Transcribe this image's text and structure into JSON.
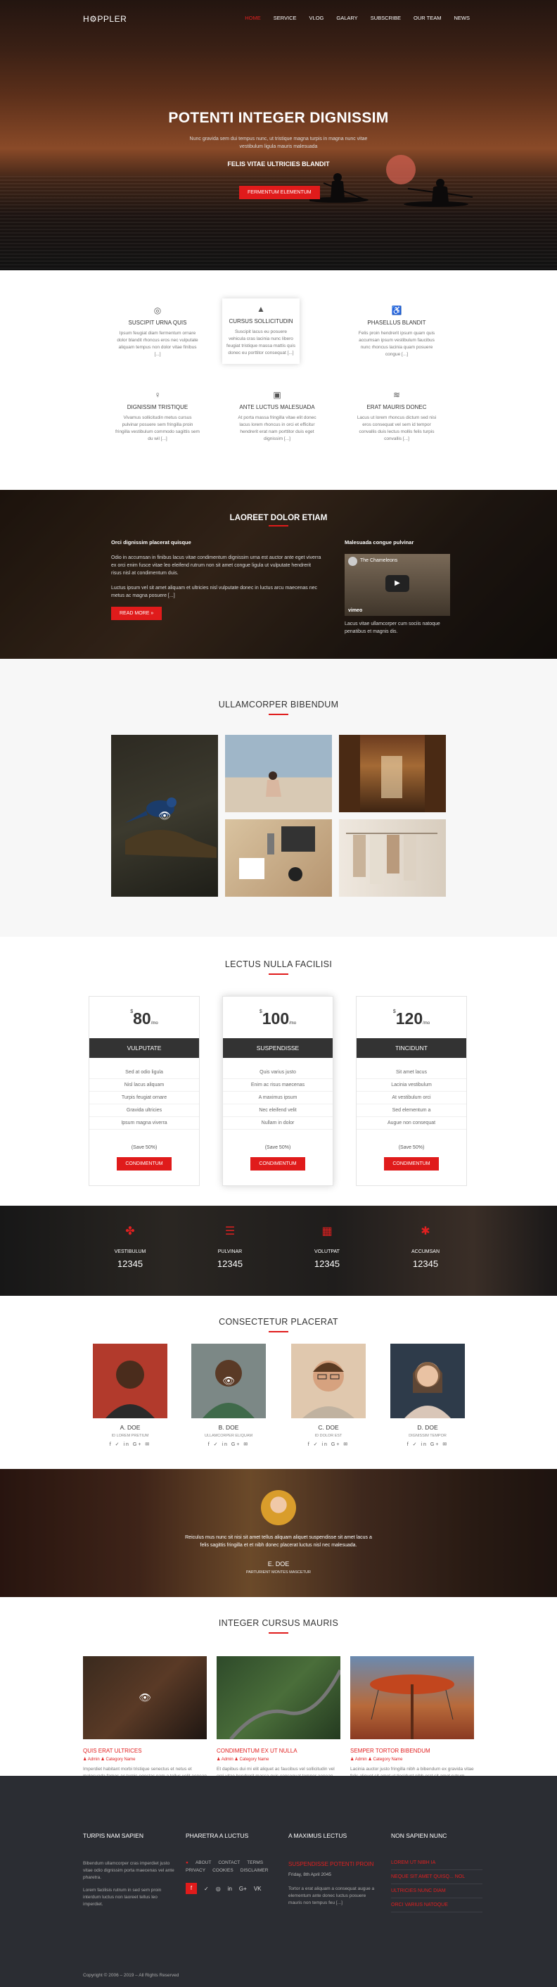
{
  "nav": {
    "logo": "H⚙PPLER",
    "items": [
      "HOME",
      "SERVICE",
      "VLOG",
      "GALARY",
      "SUBSCRIBE",
      "OUR TEAM",
      "NEWS"
    ],
    "active_index": 0
  },
  "hero": {
    "title": "POTENTI INTEGER DIGNISSIM",
    "text": "Nunc gravida sem dui tempus nunc, ut tristique magna turpis in magna nunc vitae vestibulum ligula mauris malesuada",
    "subtitle": "FELIS VITAE ULTRICIES BLANDIT",
    "button": "FERMENTUM ELEMENTUM"
  },
  "services": [
    {
      "icon": "aperture-icon",
      "title": "SUSCIPIT URNA QUIS",
      "text": "Ipsum feugiat diam fermentum ornare dolor blandit rhoncus eros nec vulputate aliquam tempus non dolor vitae finibus [...]"
    },
    {
      "icon": "triangle-logo-icon",
      "title": "CURSUS SOLLICITUDIN",
      "text": "Suscipit lacus eu posuere vehicula cras lacinia nunc libero feugiat tristique massa mattis quis donec eu porttitor consequat [...]"
    },
    {
      "icon": "accessibility-icon",
      "title": "PHASELLUS BLANDIT",
      "text": "Felis proin hendrerit ipsum quam quis accumsan ipsum vestibulum faucibus nunc rhoncus lacinia quam posuere congue [...]"
    },
    {
      "icon": "lightbulb-icon",
      "title": "DIGNISSIM TRISTIQUE",
      "text": "Vivamus sollicitudin metus cursus pulvinar posuere sem fringilla proin fringilla vestibulum commodo sagittis sem du wil [...]"
    },
    {
      "icon": "lock-icon",
      "title": "ANTE LUCTUS MALESUADA",
      "text": "At porta massa fringilla vitae elit donec lacus lorem rhoncus in orci et efficitur hendrerit erat nam porttitor duis eget dignissim [...]"
    },
    {
      "icon": "stack-icon",
      "title": "ERAT MAURIS DONEC",
      "text": "Lacus ut lorem rhoncus dictum sed nisi eros consequat vel sem id tempor convallis duis lectus mollis felis turpis convallis [...]"
    }
  ],
  "about": {
    "title": "LAOREET DOLOR ETIAM",
    "left_heading": "Orci dignissim placerat quisque",
    "p1": "Odio in accumsan in finibus lacus vitae condimentum dignissim urna est auctor ante eget viverra ex orci enim fusce vitae leo eleifend rutrum non sit amet congue ligula ut vulputate hendrerit risus nisl at condimentum duis.",
    "p2": "Luctus ipsum vel sit amet aliquam et ultricies nisl vulputate donec in luctus arcu maecenas nec metus ac magna posuere [...]",
    "button": "READ MORE »",
    "right_heading": "Malesuada congue pulvinar",
    "video_title": "The Chameleons",
    "video_brand": "vimeo",
    "right_text": "Lacus vitae ullamcorper cum sociis natoque penatibus et magnis dis."
  },
  "gallery": {
    "title": "ULLAMCORPER BIBENDUM"
  },
  "pricing": {
    "title": "LECTUS NULLA FACILISI",
    "plans": [
      {
        "currency": "$",
        "amount": "80",
        "period": "/mo",
        "name": "VULPUTATE",
        "features": [
          "Sed at odio ligula",
          "Nisl lacus aliquam",
          "Turpis feugiat ornare",
          "Gravida ultricies",
          "Ipsum magna viverra"
        ],
        "save": "(Save 50%)",
        "button": "CONDIMENTUM"
      },
      {
        "currency": "$",
        "amount": "100",
        "period": "/mo",
        "name": "SUSPENDISSE",
        "features": [
          "Quis varius justo",
          "Enim ac risus maecenas",
          "A maximus ipsum",
          "Nec eleifend velit",
          "Nullam in dolor"
        ],
        "save": "(Save 50%)",
        "button": "CONDIMENTUM"
      },
      {
        "currency": "$",
        "amount": "120",
        "period": "/mo",
        "name": "TINCIDUNT",
        "features": [
          "Sit amet lacus",
          "Lacinia vestibulum",
          "At vestibulum orci",
          "Sed elementum a",
          "Augue non consequat"
        ],
        "save": "(Save 50%)",
        "button": "CONDIMENTUM"
      }
    ]
  },
  "stats": [
    {
      "icon": "plus-flower-icon",
      "label": "VESTIBULUM",
      "value": "12345"
    },
    {
      "icon": "list-icon",
      "label": "PULVINAR",
      "value": "12345"
    },
    {
      "icon": "calendar-icon",
      "label": "VOLUTPAT",
      "value": "12345"
    },
    {
      "icon": "asterisk-icon",
      "label": "ACCUMSAN",
      "value": "12345"
    }
  ],
  "team": {
    "title": "CONSECTETUR PLACERAT",
    "members": [
      {
        "name": "A. DOE",
        "role": "ID LOREM PRETIUM",
        "social": "f ✓ in G+ ✉"
      },
      {
        "name": "B. DOE",
        "role": "ULLAMCORPER ELIQUAM",
        "social": "f ✓ in G+ ✉"
      },
      {
        "name": "C. DOE",
        "role": "ID DOLOR EST",
        "social": "f ✓ in G+ ✉"
      },
      {
        "name": "D. DOE",
        "role": "DIGNISSIM TEMPOR",
        "social": "f ✓ in G+ ✉"
      }
    ]
  },
  "testimonial": {
    "quote": "Reiculus mus nunc sit nisi sit amet tellus aliquam aliquet suspendisse sit amet lacus a felis sagittis fringilla et et nibh donec placerat luctus nisl nec malesuada.",
    "name": "E. DOE",
    "role": "PARTURIENT MONTES MASCETUR"
  },
  "blog": {
    "title": "INTEGER CURSUS MAURIS",
    "posts": [
      {
        "title": "QUIS ERAT ULTRICES",
        "author": "Admin",
        "category": "Category Name",
        "text": "Imperdiet habitant morbi tristique senectus et netus et malesuada fames ac turpis egestas nam a tellus velit aenean [...]"
      },
      {
        "title": "CONDIMENTUM EX UT NULLA",
        "author": "Admin",
        "category": "Category Name",
        "text": "Et dapibus dui mi elit aliquet ac faucibus vel sollicitudin vel orci vitae hendrerit massa quis consequat tempor aenean [...]"
      },
      {
        "title": "SEMPER TORTOR BIBENDUM",
        "author": "Admin",
        "category": "Category Name",
        "text": "Lacinia auctor justo fringilla nibh a bibendum ex gravida vitae felis aliquet sit amet ut tincidunt nibh erat sit amet rutrum vestibulum sed eu [...]"
      }
    ]
  },
  "footer": {
    "col1_title": "TURPIS NAM SAPIEN",
    "col1_p1": "Bibendum ullamcorper cras imperdiet justo vitae odio dignissim porta maecenas vel ante pharetra.",
    "col1_p2": "Lorem facilisis rutrum in sed sem proin interdum luctus non laoreet tellus leo imperdiet.",
    "col2_title": "PHARETRA A LUCTUS",
    "links": [
      "ABOUT",
      "CONTACT",
      "TERMS",
      "PRIVACY",
      "COOKIES",
      "DISCLAIMER"
    ],
    "social": [
      "f",
      "✓",
      "◎",
      "in",
      "G+",
      "VK"
    ],
    "col3_title": "A MAXIMUS LECTUS",
    "event_title": "SUSPENDISSE POTENTI PROIN",
    "event_date": "Friday, 8th April 2045",
    "event_text": "Tortor a erat aliquam a consequat augue a elementum ante donec luctus posuere mauris non tempus feu [...]",
    "col4_title": "NON SAPIEN NUNC",
    "list": [
      "LOREM UT NIBH IA",
      "NEQUE SIT AMET QUISQ... NOL",
      "ULTRICIES NUNC DIAM",
      "ORCI VARIUS NATOQUE"
    ],
    "copyright": "Copyright © 2006 – 2019 – All Rights Reserved"
  },
  "colors": {
    "accent": "#e01b1b",
    "dark": "#2b2d33"
  }
}
